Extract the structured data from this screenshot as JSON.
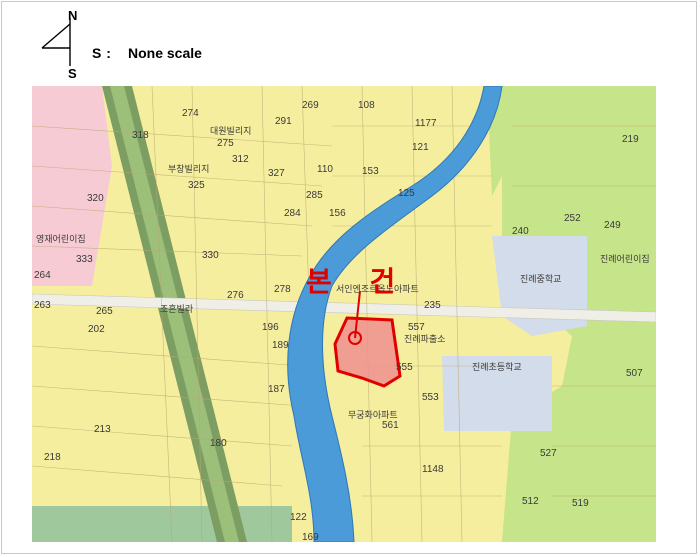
{
  "legend": {
    "north": "N",
    "south": "S",
    "scale_key": "S :",
    "scale_value": "None scale"
  },
  "map": {
    "subject_label": "본 건",
    "subject_color": "#e00000",
    "river_color": "#4a9bd8",
    "parcel_labels": [
      "274",
      "269",
      "108",
      "1177",
      "318",
      "291",
      "275",
      "312",
      "327",
      "110",
      "153",
      "121",
      "325",
      "285",
      "125",
      "320",
      "333",
      "330",
      "284",
      "156",
      "240",
      "252",
      "249",
      "219",
      "264",
      "276",
      "278",
      "235",
      "263",
      "265",
      "557",
      "507",
      "196",
      "189",
      "555",
      "553",
      "180",
      "218",
      "213",
      "561",
      "527",
      "512",
      "519",
      "122",
      "169",
      "202",
      "187",
      "1148"
    ],
    "place_labels": [
      "대원빌리지",
      "부창빌리지",
      "영재어린이집",
      "진례중학교",
      "진례초등학교",
      "진례어린이집",
      "조흔빌라",
      "서인엔조르옵노아파트",
      "진례파출소",
      "무궁화아파트"
    ]
  }
}
